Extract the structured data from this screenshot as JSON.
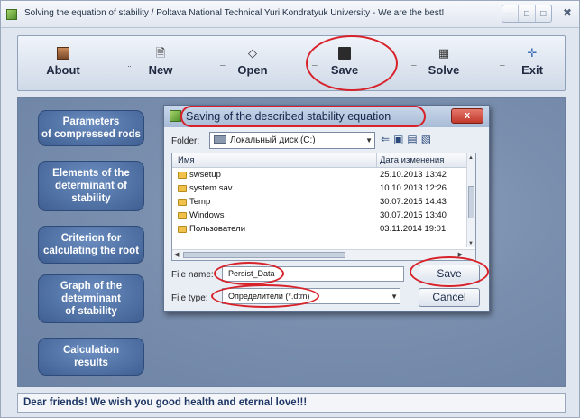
{
  "window": {
    "title": "Solving the equation of stability / Poltava National Technical Yuri Kondratyuk University - We are    the best!"
  },
  "toolbar": {
    "items": [
      {
        "label": "About",
        "icon": "person-icon"
      },
      {
        "label": "New",
        "icon": "new-document-icon"
      },
      {
        "label": "Open",
        "icon": "open-icon"
      },
      {
        "label": "Save",
        "icon": "floppy-disk-icon"
      },
      {
        "label": "Solve",
        "icon": "solve-icon"
      },
      {
        "label": "Exit",
        "icon": "exit-icon"
      }
    ]
  },
  "sidebar": {
    "buttons": [
      {
        "label": "Parameters\nof compressed rods"
      },
      {
        "label": "Elements of the\ndeterminant of\nstability"
      },
      {
        "label": "Criterion for\ncalculating the root"
      },
      {
        "label": "Graph of the\ndeterminant\nof stability"
      },
      {
        "label": "Calculation\nresults"
      }
    ]
  },
  "dialog": {
    "title": "Saving of the described stability equation",
    "close_label": "x",
    "folder_label": "Folder:",
    "folder_value": "Локальный диск (C:)",
    "columns": [
      "Имя",
      "Дата изменения"
    ],
    "files": [
      {
        "name": "swsetup",
        "date": "25.10.2013 13:42"
      },
      {
        "name": "system.sav",
        "date": "10.10.2013 12:26"
      },
      {
        "name": "Temp",
        "date": "30.07.2015 14:43"
      },
      {
        "name": "Windows",
        "date": "30.07.2015 13:40"
      },
      {
        "name": "Пользователи",
        "date": "03.11.2014 19:01"
      }
    ],
    "file_name_label": "File name:",
    "file_name_value": "Persist_Data",
    "file_type_label": "File type:",
    "file_type_value": "Определители (*.dtm)",
    "save_button": "Save",
    "cancel_button": "Cancel"
  },
  "status": {
    "text": "Dear friends! We wish you good health and eternal love!!!"
  },
  "colors": {
    "annotation": "#d8222a",
    "side_button": "#3f5f93",
    "status_text": "#1f3766"
  }
}
